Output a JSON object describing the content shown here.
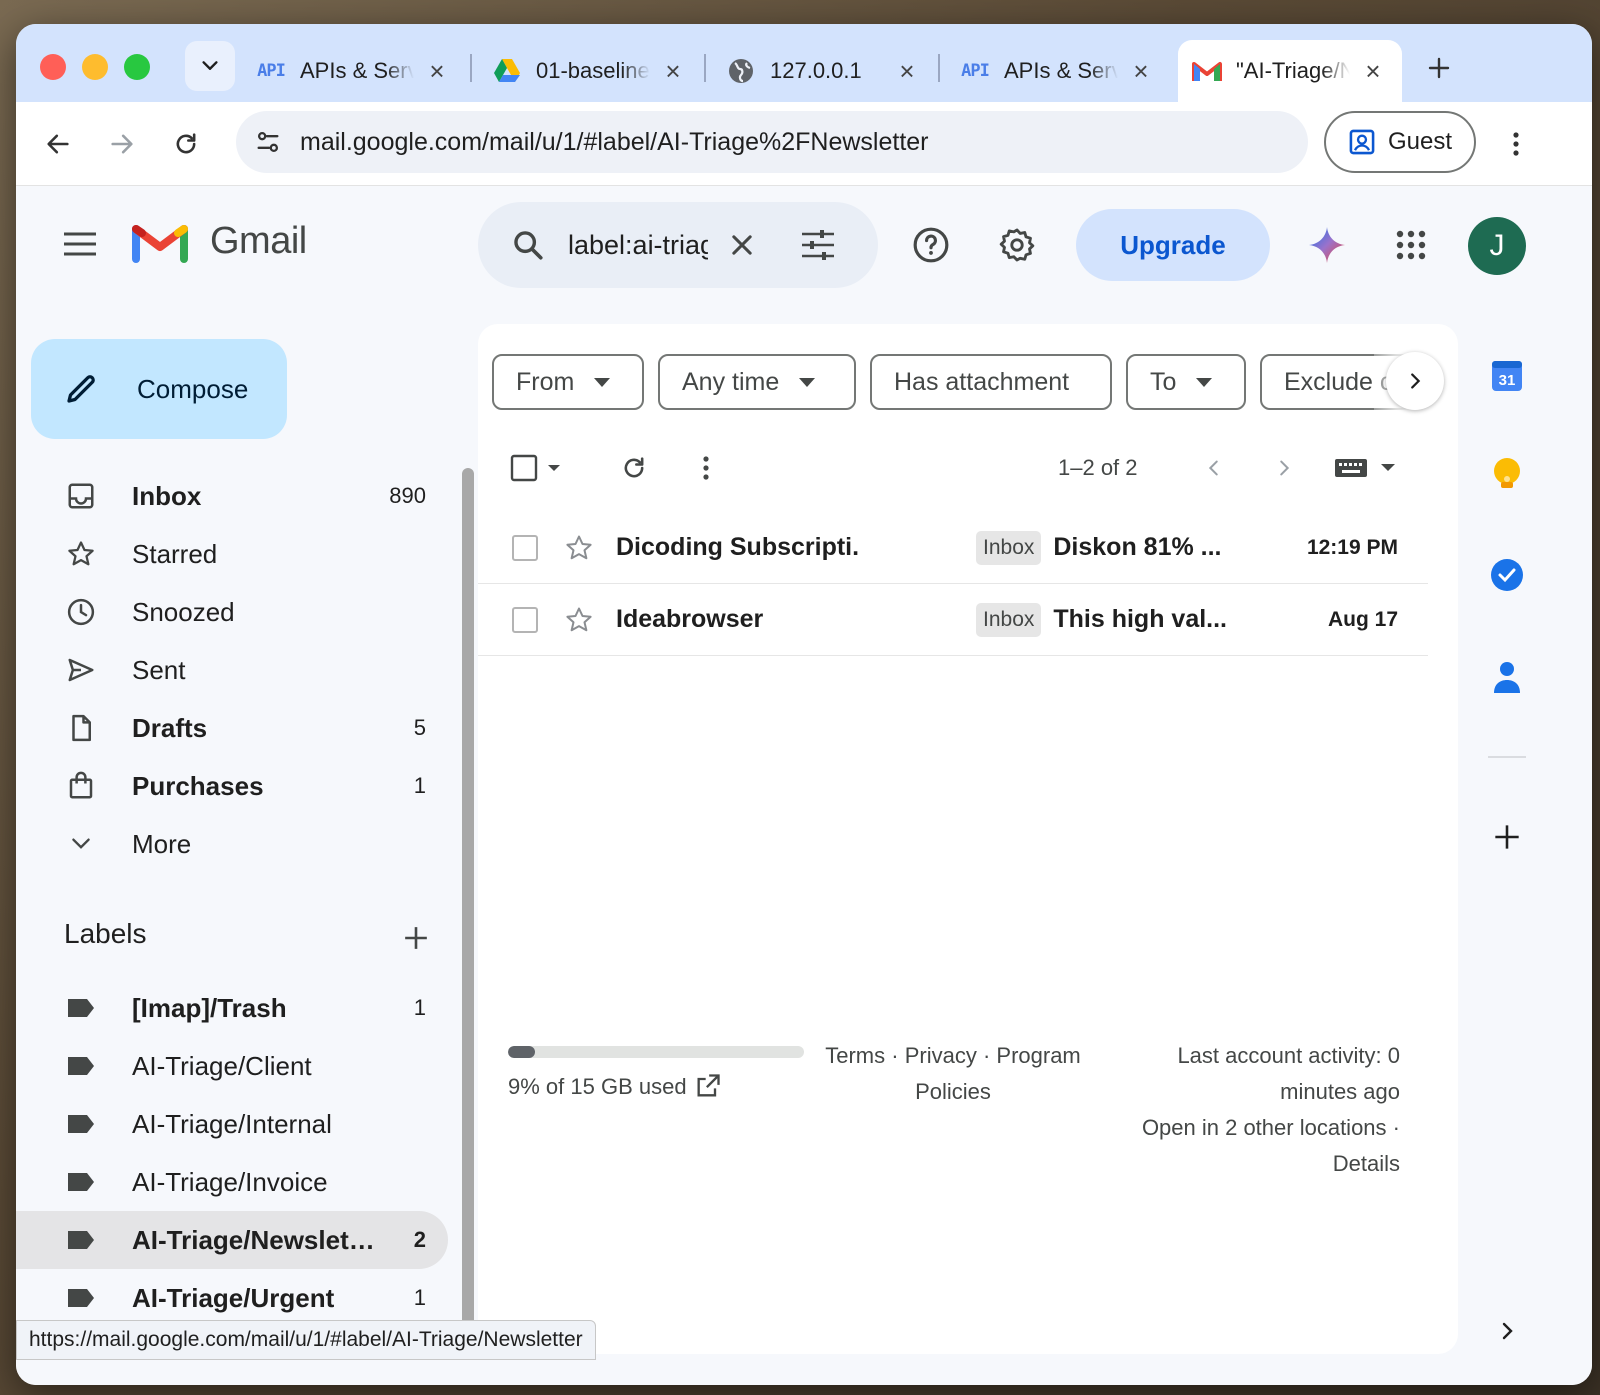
{
  "browser": {
    "tabs": [
      {
        "title": "APIs & Services",
        "favicon": "api-badge-icon",
        "badge": "API"
      },
      {
        "title": "01-baseline",
        "favicon": "google-drive-icon"
      },
      {
        "title": "127.0.0.1",
        "favicon": "globe-icon"
      },
      {
        "title": "APIs & Services",
        "favicon": "api-badge-icon",
        "badge": "API"
      },
      {
        "title": "\"AI-Triage/Newsletter\"",
        "favicon": "gmail-icon",
        "active": true
      }
    ],
    "url": "mail.google.com/mail/u/1/#label/AI-Triage%2FNewsletter",
    "profile_label": "Guest",
    "status_bar_url": "https://mail.google.com/mail/u/1/#label/AI-Triage/Newsletter"
  },
  "gmail": {
    "wordmark": "Gmail",
    "search_value": "label:ai-triage-newsletter",
    "upgrade_label": "Upgrade",
    "avatar_initial": "J",
    "compose_label": "Compose",
    "nav": [
      {
        "label": "Inbox",
        "count": "890",
        "icon": "inbox-icon",
        "bold": true
      },
      {
        "label": "Starred",
        "count": "",
        "icon": "star-icon",
        "bold": false
      },
      {
        "label": "Snoozed",
        "count": "",
        "icon": "clock-icon",
        "bold": false
      },
      {
        "label": "Sent",
        "count": "",
        "icon": "send-icon",
        "bold": false
      },
      {
        "label": "Drafts",
        "count": "5",
        "icon": "draft-icon",
        "bold": true
      },
      {
        "label": "Purchases",
        "count": "1",
        "icon": "shopping-bag-icon",
        "bold": true
      },
      {
        "label": "More",
        "count": "",
        "icon": "chevron-down-icon",
        "bold": false
      }
    ],
    "labels_heading": "Labels",
    "labels": [
      {
        "label": "[Imap]/Trash",
        "count": "1",
        "bold": true
      },
      {
        "label": "AI-Triage/Client",
        "count": "",
        "bold": false
      },
      {
        "label": "AI-Triage/Internal",
        "count": "",
        "bold": false
      },
      {
        "label": "AI-Triage/Invoice",
        "count": "",
        "bold": false
      },
      {
        "label": "AI-Triage/Newsletter",
        "count": "2",
        "bold": true,
        "selected": true
      },
      {
        "label": "AI-Triage/Urgent",
        "count": "1",
        "bold": true
      }
    ],
    "filter_chips": [
      "From",
      "Any time",
      "Has attachment",
      "To",
      "Exclude chats"
    ],
    "page_range": "1–2 of 2",
    "emails": [
      {
        "sender": "Dicoding Subscripti.",
        "badge": "Inbox",
        "subject": "Diskon 81% ...",
        "date": "12:19 PM"
      },
      {
        "sender": "Ideabrowser",
        "badge": "Inbox",
        "subject": "This high val...",
        "date": "Aug 17"
      }
    ],
    "storage": {
      "text": "9% of 15 GB used",
      "percent_used": 9
    },
    "footer": {
      "terms": "Terms",
      "privacy": "Privacy",
      "program_policies": "Program Policies",
      "activity_line1": "Last account activity: 0 minutes ago",
      "activity_line2": "Open in 2 other locations",
      "details": "Details"
    },
    "side_apps": [
      "calendar-icon",
      "keep-icon",
      "tasks-icon",
      "contacts-icon"
    ],
    "calendar_day": "31"
  },
  "colors": {
    "accent_blue": "#0b57d0",
    "compose_bg": "#c2e7ff",
    "tabstrip_bg": "#d3e3fd",
    "avatar_bg": "#1e6b52"
  }
}
